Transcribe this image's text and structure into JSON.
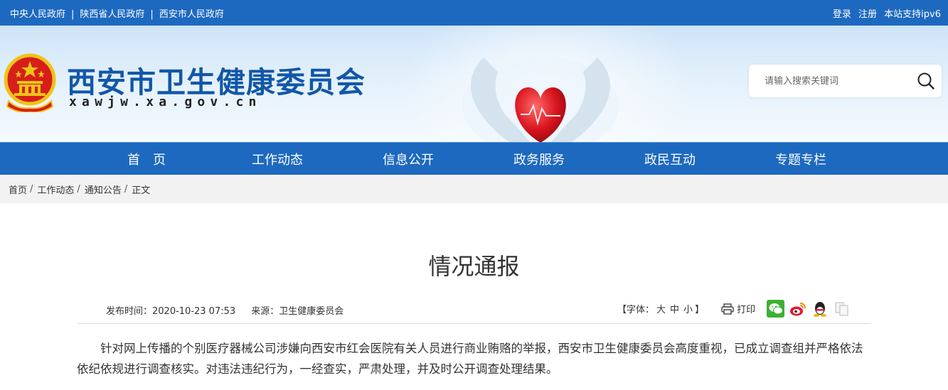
{
  "topbar": {
    "links": [
      "中央人民政府",
      "陕西省人民政府",
      "西安市人民政府"
    ],
    "separator": "|",
    "login": "登录",
    "register": "注册",
    "ipv6": "本站支持ipv6"
  },
  "header": {
    "title": "西安市卫生健康委员会",
    "domain": "xawjw.xa.gov.cn",
    "search_placeholder": "请输入搜索关键词"
  },
  "nav": {
    "items": [
      "首　页",
      "工作动态",
      "信息公开",
      "政务服务",
      "政民互动",
      "专题专栏"
    ]
  },
  "breadcrumb": {
    "items": [
      "首页",
      "工作动态",
      "通知公告",
      "正文"
    ],
    "separator": "/"
  },
  "article": {
    "title": "情况通报",
    "publish_time": "发布时间：2020-10-23 07:53",
    "source": "来源：卫生健康委员会",
    "font_label_open": "【字体：",
    "font_large": "大",
    "font_medium": "中",
    "font_small": "小",
    "font_label_close": "】",
    "print": "打印",
    "body": "针对网上传播的个别医疗器械公司涉嫌向西安市红会医院有关人员进行商业贿赂的举报，西安市卫生健康委员会高度重视，已成立调查组并严格依法依纪依规进行调查核实。对违法违纪行为，一经查实，严肃处理，并及时公开调查处理结果。"
  },
  "colors": {
    "brand_blue": "#1d69bf",
    "title_blue": "#1257a8",
    "wechat_green": "#3cb034",
    "weibo_red": "#e6162d",
    "qq_blue": "#2a8ce0"
  },
  "share_icons": [
    "wechat-icon",
    "weibo-icon",
    "qq-icon",
    "copy-icon"
  ]
}
